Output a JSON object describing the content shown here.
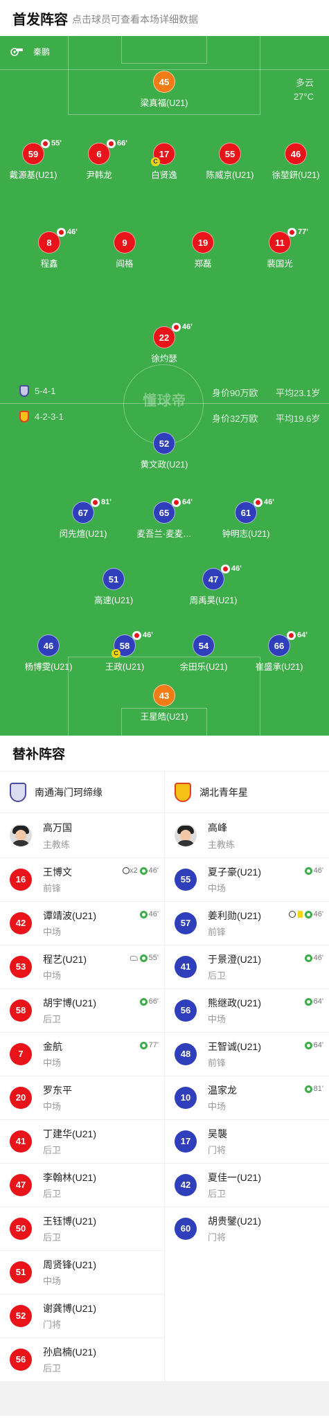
{
  "header": {
    "title": "首发阵容",
    "subtitle": "点击球员可查看本场详细数据"
  },
  "referee": {
    "name": "秦鹏",
    "icon": "whistle-icon"
  },
  "weather": {
    "condition": "多云",
    "temperature": "27°C"
  },
  "colors": {
    "pitch": "#3cad48",
    "home": "#e8141a",
    "away": "#2f3fbb",
    "goalkeeper": "#f17c17"
  },
  "home": {
    "team_name": "南通海门珂缔缘",
    "formation": "5-4-1",
    "value": "身价90万欧",
    "avg_age": "平均23.1岁",
    "coach": {
      "name": "高万国",
      "role": "主教练"
    },
    "starters": [
      {
        "num": "45",
        "name": "梁真福(U21)",
        "gk": true
      },
      {
        "num": "59",
        "name": "戴源基(U21)",
        "sub": "55'"
      },
      {
        "num": "6",
        "name": "尹韩龙",
        "sub": "66'"
      },
      {
        "num": "17",
        "name": "白贤逸",
        "captain": true
      },
      {
        "num": "55",
        "name": "陈威京(U21)"
      },
      {
        "num": "46",
        "name": "徐堃鈃(U21)"
      },
      {
        "num": "8",
        "name": "程鑫",
        "sub": "46'"
      },
      {
        "num": "9",
        "name": "阎格"
      },
      {
        "num": "19",
        "name": "郑磊"
      },
      {
        "num": "11",
        "name": "裴国光",
        "sub": "77'"
      },
      {
        "num": "22",
        "name": "徐灼瑟",
        "sub": "46'"
      }
    ],
    "subs": [
      {
        "num": "16",
        "name": "王博文",
        "pos": "前锋",
        "events": {
          "goals": "x2",
          "in": "46'"
        }
      },
      {
        "num": "42",
        "name": "谭靖波(U21)",
        "pos": "中场",
        "events": {
          "in": "46'"
        }
      },
      {
        "num": "53",
        "name": "程艺(U21)",
        "pos": "中场",
        "events": {
          "assist": true,
          "in": "55'"
        }
      },
      {
        "num": "58",
        "name": "胡宇博(U21)",
        "pos": "后卫",
        "events": {
          "in": "66'"
        }
      },
      {
        "num": "7",
        "name": "金航",
        "pos": "中场",
        "events": {
          "in": "77'"
        }
      },
      {
        "num": "20",
        "name": "罗东平",
        "pos": "中场"
      },
      {
        "num": "41",
        "name": "丁建华(U21)",
        "pos": "后卫"
      },
      {
        "num": "47",
        "name": "李翰林(U21)",
        "pos": "后卫"
      },
      {
        "num": "50",
        "name": "王钰博(U21)",
        "pos": "后卫"
      },
      {
        "num": "51",
        "name": "周贤锋(U21)",
        "pos": "中场"
      },
      {
        "num": "52",
        "name": "谢龚博(U21)",
        "pos": "门将"
      },
      {
        "num": "56",
        "name": "孙启楠(U21)",
        "pos": "后卫"
      }
    ]
  },
  "away": {
    "team_name": "湖北青年星",
    "formation": "4-2-3-1",
    "value": "身价32万欧",
    "avg_age": "平均19.6岁",
    "coach": {
      "name": "高峰",
      "role": "主教练"
    },
    "starters": [
      {
        "num": "52",
        "name": "黄文政(U21)"
      },
      {
        "num": "67",
        "name": "闵先煊(U21)",
        "sub": "81'"
      },
      {
        "num": "65",
        "name": "麦吾兰·麦麦…",
        "sub": "64'"
      },
      {
        "num": "61",
        "name": "钟明志(U21)",
        "sub": "46'"
      },
      {
        "num": "51",
        "name": "高速(U21)"
      },
      {
        "num": "47",
        "name": "周禹昊(U21)",
        "sub": "46'"
      },
      {
        "num": "46",
        "name": "杨博雯(U21)"
      },
      {
        "num": "58",
        "name": "王政(U21)",
        "sub": "46'",
        "captain": true
      },
      {
        "num": "54",
        "name": "余田乐(U21)"
      },
      {
        "num": "66",
        "name": "崔盛承(U21)",
        "sub": "64'"
      },
      {
        "num": "43",
        "name": "王星皓(U21)",
        "gk": true
      }
    ],
    "subs": [
      {
        "num": "55",
        "name": "夏子豪(U21)",
        "pos": "中场",
        "events": {
          "in": "46'"
        }
      },
      {
        "num": "57",
        "name": "姜利勋(U21)",
        "pos": "前锋",
        "events": {
          "goal": true,
          "yellow": true,
          "in": "46'"
        }
      },
      {
        "num": "41",
        "name": "于景澄(U21)",
        "pos": "后卫",
        "events": {
          "in": "46'"
        }
      },
      {
        "num": "56",
        "name": "熊继政(U21)",
        "pos": "中场",
        "events": {
          "in": "64'"
        }
      },
      {
        "num": "48",
        "name": "王智诚(U21)",
        "pos": "前锋",
        "events": {
          "in": "64'"
        }
      },
      {
        "num": "10",
        "name": "温家龙",
        "pos": "中场",
        "events": {
          "in": "81'"
        }
      },
      {
        "num": "17",
        "name": "吴襲",
        "pos": "门将"
      },
      {
        "num": "42",
        "name": "夏佳一(U21)",
        "pos": "后卫"
      },
      {
        "num": "60",
        "name": "胡贵鐾(U21)",
        "pos": "门将"
      }
    ]
  },
  "watermark": "懂球帝",
  "subs_section": {
    "title": "替补阵容"
  }
}
